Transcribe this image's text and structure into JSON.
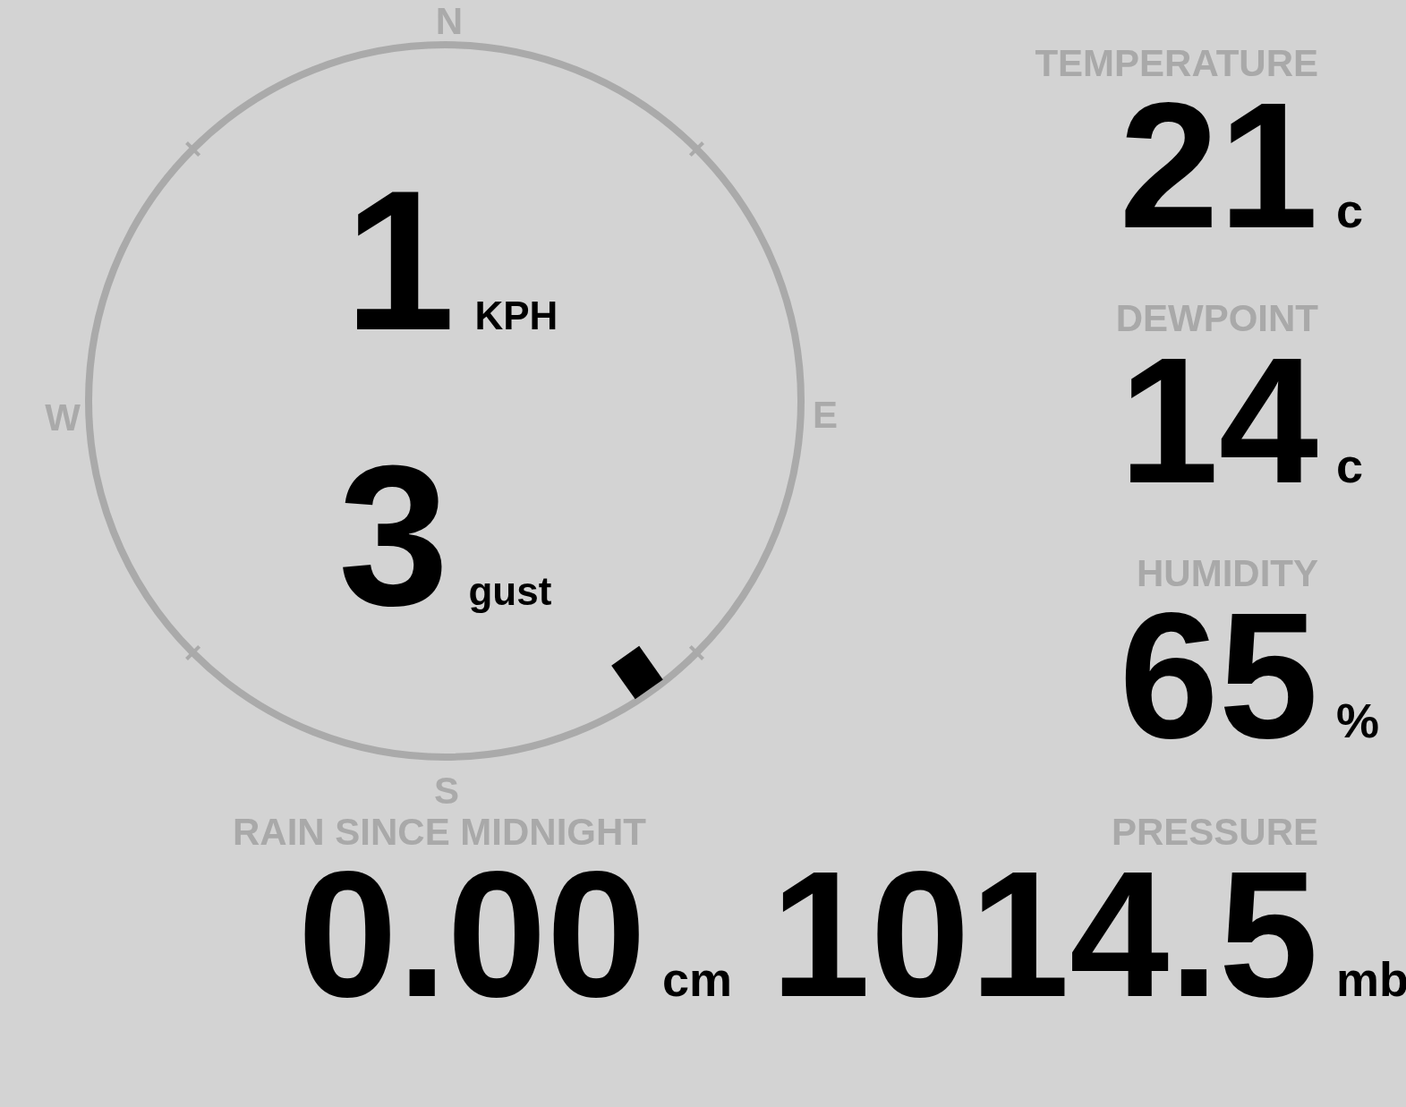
{
  "compass": {
    "north": "N",
    "east": "E",
    "south": "S",
    "west": "W"
  },
  "wind": {
    "speed": "1",
    "speed_unit": "KPH",
    "gust": "3",
    "gust_unit": "gust"
  },
  "stats": [
    {
      "label": "TEMPERATURE",
      "value": "21",
      "unit": "c"
    },
    {
      "label": "DEWPOINT",
      "value": "14",
      "unit": "c"
    },
    {
      "label": "HUMIDITY",
      "value": "65",
      "unit": "%"
    }
  ],
  "rain": {
    "label": "RAIN SINCE MIDNIGHT",
    "value": "0.00",
    "unit": "cm"
  },
  "pressure": {
    "label": "PRESSURE",
    "value": "1014.5",
    "unit": "mb"
  }
}
